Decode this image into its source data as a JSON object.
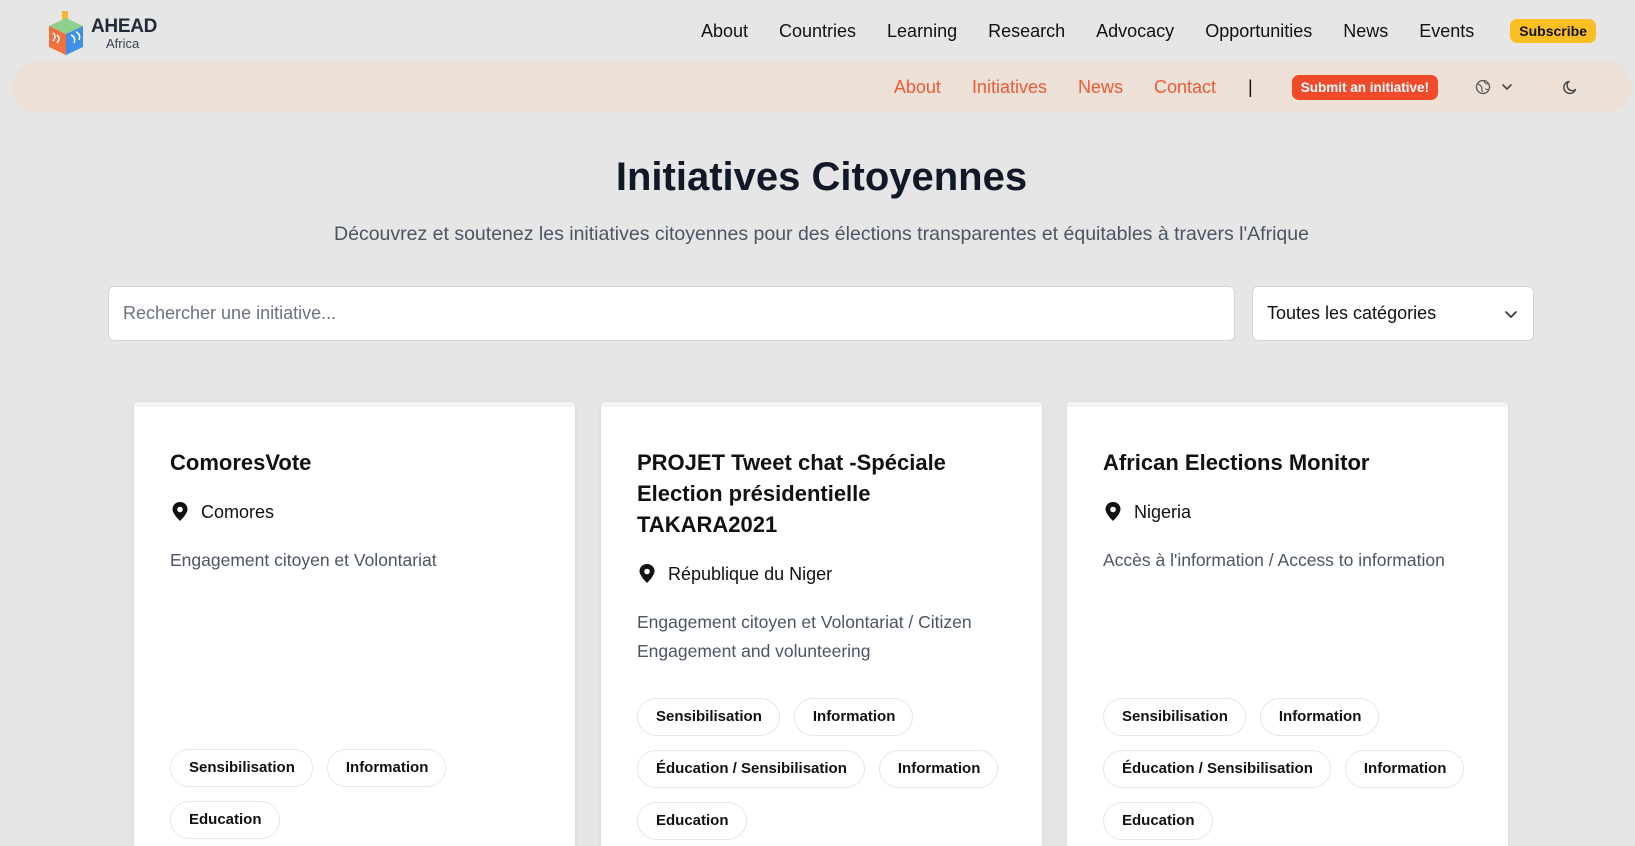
{
  "brand": {
    "name": "AHEAD",
    "sub": "Africa"
  },
  "main_nav": [
    "About",
    "Countries",
    "Learning",
    "Research",
    "Advocacy",
    "Opportunities",
    "News",
    "Events"
  ],
  "subscribe_label": "Subscribe",
  "sub_nav": [
    "About",
    "Initiatives",
    "News",
    "Contact"
  ],
  "sub_nav_separator": "|",
  "submit_label": "Submit an initiative!",
  "icons": {
    "language": "globe-icon",
    "language_dropdown": "chevron-down-icon",
    "theme": "moon-icon",
    "location": "map-pin-icon"
  },
  "page": {
    "title": "Initiatives Citoyennes",
    "subtitle": "Découvrez et soutenez les initiatives citoyennes pour des élections transparentes et équitables à travers l'Afrique"
  },
  "search": {
    "placeholder": "Rechercher une initiative..."
  },
  "category_filter": {
    "selected": "Toutes les catégories"
  },
  "cards": [
    {
      "title": "ComoresVote",
      "location": "Comores",
      "description": "Engagement citoyen et Volontariat",
      "tags": [
        "Sensibilisation",
        "Information",
        "Education"
      ]
    },
    {
      "title": "PROJET Tweet chat -Spéciale Election présidentielle TAKARA2021",
      "location": "République du Niger",
      "description": "Engagement citoyen et Volontariat / Citizen Engagement and volunteering",
      "tags": [
        "Sensibilisation",
        "Information",
        "Éducation / Sensibilisation",
        "Information",
        "Education"
      ]
    },
    {
      "title": "African Elections Monitor",
      "location": "Nigeria",
      "description": "Accès à l'information / Access to information",
      "tags": [
        "Sensibilisation",
        "Information",
        "Éducation / Sensibilisation",
        "Information",
        "Education"
      ]
    }
  ],
  "colors": {
    "accent": "#f05a33",
    "subscribe": "#fbbf24",
    "submit": "#f04a2a",
    "subnav_bg": "#ede0d7",
    "page_bg": "#e6e6e6"
  }
}
